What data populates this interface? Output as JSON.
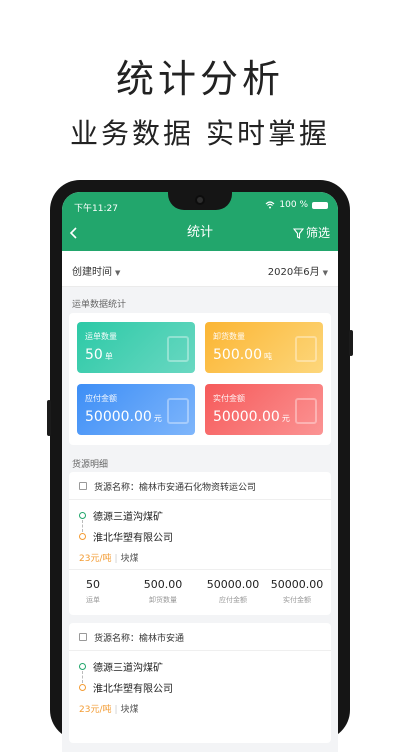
{
  "promo": {
    "title": "统计分析",
    "subtitle": "业务数据  实时掌握"
  },
  "status": {
    "time": "下午11:27",
    "battery": "100 %"
  },
  "nav": {
    "back_icon": "chevron-left-icon",
    "title": "统计",
    "filter_label": "筛选"
  },
  "filters": {
    "time_label": "创建时间",
    "month": "2020年6月"
  },
  "summary": {
    "section_label": "运单数据统计",
    "tiles": [
      {
        "label": "运单数量",
        "value": "50",
        "unit": "单",
        "color_from": "#2cc9a6",
        "color_to": "#6ad8c2"
      },
      {
        "label": "卸货数量",
        "value": "500.00",
        "unit": "吨",
        "color_from": "#fbb533",
        "color_to": "#fdd77c"
      },
      {
        "label": "应付金额",
        "value": "50000.00",
        "unit": "元",
        "color_from": "#3d8ef6",
        "color_to": "#7fb6fb"
      },
      {
        "label": "实付金额",
        "value": "50000.00",
        "unit": "元",
        "color_from": "#f65a5a",
        "color_to": "#fb9494"
      }
    ]
  },
  "detail": {
    "section_label": "货源明细",
    "items": [
      {
        "source": "货源名称：榆林市安通石化物资转运公司",
        "from": "德源三道沟煤矿",
        "to": "淮北华塑有限公司",
        "price": "23元/吨",
        "kind": "块煤",
        "stats": [
          {
            "value": "50",
            "label": "运单"
          },
          {
            "value": "500.00",
            "label": "卸货数量"
          },
          {
            "value": "50000.00",
            "label": "应付金额"
          },
          {
            "value": "50000.00",
            "label": "实付金额"
          }
        ]
      },
      {
        "source": "货源名称：榆林市安通",
        "from": "德源三道沟煤矿",
        "to": "淮北华塑有限公司",
        "price": "23元/吨",
        "kind": "块煤"
      }
    ]
  },
  "colors": {
    "primary": "#22a66c",
    "accent_orange": "#f39c34"
  }
}
